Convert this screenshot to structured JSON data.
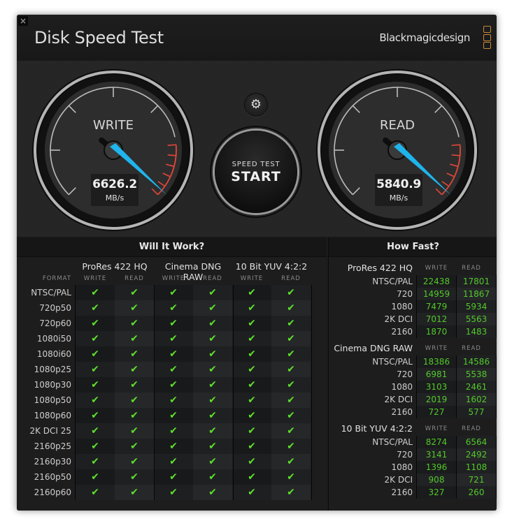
{
  "window": {
    "close_label": "×",
    "title": "Disk Speed Test",
    "brand": "Blackmagicdesign"
  },
  "gauges": {
    "write": {
      "label": "WRITE",
      "value": "6626.2",
      "unit": "MB/s"
    },
    "read": {
      "label": "READ",
      "value": "5840.9",
      "unit": "MB/s"
    }
  },
  "controls": {
    "settings_icon": "⚙",
    "start_top": "SPEED TEST",
    "start_main": "START"
  },
  "will_it_work": {
    "title": "Will It Work?",
    "format_label": "FORMAT",
    "groups": [
      "ProRes 422 HQ",
      "Cinema DNG RAW",
      "10 Bit YUV 4:2:2"
    ],
    "subheaders": [
      "WRITE",
      "READ",
      "WRITE",
      "READ",
      "WRITE",
      "READ"
    ],
    "check_glyph": "✔",
    "rows": [
      {
        "label": "NTSC/PAL",
        "results": [
          true,
          true,
          true,
          true,
          true,
          true
        ]
      },
      {
        "label": "720p50",
        "results": [
          true,
          true,
          true,
          true,
          true,
          true
        ]
      },
      {
        "label": "720p60",
        "results": [
          true,
          true,
          true,
          true,
          true,
          true
        ]
      },
      {
        "label": "1080i50",
        "results": [
          true,
          true,
          true,
          true,
          true,
          true
        ]
      },
      {
        "label": "1080i60",
        "results": [
          true,
          true,
          true,
          true,
          true,
          true
        ]
      },
      {
        "label": "1080p25",
        "results": [
          true,
          true,
          true,
          true,
          true,
          true
        ]
      },
      {
        "label": "1080p30",
        "results": [
          true,
          true,
          true,
          true,
          true,
          true
        ]
      },
      {
        "label": "1080p50",
        "results": [
          true,
          true,
          true,
          true,
          true,
          true
        ]
      },
      {
        "label": "1080p60",
        "results": [
          true,
          true,
          true,
          true,
          true,
          true
        ]
      },
      {
        "label": "2K DCI 25",
        "results": [
          true,
          true,
          true,
          true,
          true,
          true
        ]
      },
      {
        "label": "2160p25",
        "results": [
          true,
          true,
          true,
          true,
          true,
          true
        ]
      },
      {
        "label": "2160p30",
        "results": [
          true,
          true,
          true,
          true,
          true,
          true
        ]
      },
      {
        "label": "2160p50",
        "results": [
          true,
          true,
          true,
          true,
          true,
          true
        ]
      },
      {
        "label": "2160p60",
        "results": [
          true,
          true,
          true,
          true,
          true,
          true
        ]
      }
    ]
  },
  "how_fast": {
    "title": "How Fast?",
    "write_label": "WRITE",
    "read_label": "READ",
    "groups": [
      {
        "name": "ProRes 422 HQ",
        "rows": [
          {
            "label": "NTSC/PAL",
            "write": "22438",
            "read": "17801"
          },
          {
            "label": "720",
            "write": "14959",
            "read": "11867"
          },
          {
            "label": "1080",
            "write": "7479",
            "read": "5934"
          },
          {
            "label": "2K DCI",
            "write": "7012",
            "read": "5563"
          },
          {
            "label": "2160",
            "write": "1870",
            "read": "1483"
          }
        ]
      },
      {
        "name": "Cinema DNG RAW",
        "rows": [
          {
            "label": "NTSC/PAL",
            "write": "18386",
            "read": "14586"
          },
          {
            "label": "720",
            "write": "6981",
            "read": "5538"
          },
          {
            "label": "1080",
            "write": "3103",
            "read": "2461"
          },
          {
            "label": "2K DCI",
            "write": "2019",
            "read": "1602"
          },
          {
            "label": "2160",
            "write": "727",
            "read": "577"
          }
        ]
      },
      {
        "name": "10 Bit YUV 4:2:2",
        "rows": [
          {
            "label": "NTSC/PAL",
            "write": "8274",
            "read": "6564"
          },
          {
            "label": "720",
            "write": "3141",
            "read": "2492"
          },
          {
            "label": "1080",
            "write": "1396",
            "read": "1108"
          },
          {
            "label": "2K DCI",
            "write": "908",
            "read": "721"
          },
          {
            "label": "2160",
            "write": "327",
            "read": "260"
          }
        ]
      }
    ]
  },
  "colors": {
    "needle": "#1fb4ec",
    "redline": "#e0473a",
    "check": "#5ee02c",
    "value_green": "#52c92a",
    "logo_orange": "#c9883a"
  }
}
